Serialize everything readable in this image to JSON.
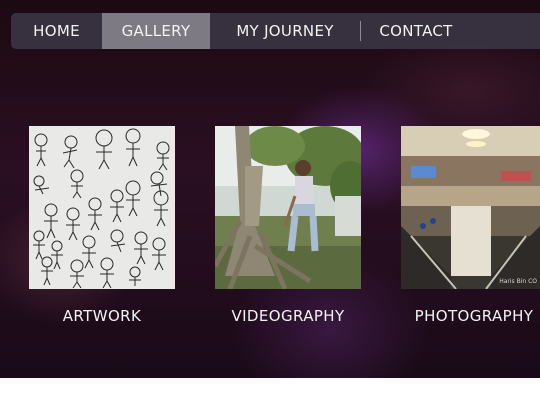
{
  "nav": {
    "items": [
      {
        "label": "HOME",
        "active": false
      },
      {
        "label": "GALLERY",
        "active": true
      },
      {
        "label": "MY JOURNEY",
        "active": false
      },
      {
        "label": "CONTACT",
        "active": false
      }
    ]
  },
  "gallery": {
    "cards": [
      {
        "label": "ARTWORK",
        "image": "chibi-sketch-sheet"
      },
      {
        "label": "VIDEOGRAPHY",
        "image": "man-sitting-on-tree-roots"
      },
      {
        "label": "PHOTOGRAPHY",
        "image": "mall-atrium-escalators",
        "watermark": "Haris Bin CO"
      }
    ]
  },
  "colors": {
    "nav_bg": "#3a3442",
    "nav_active_bg": "#7d7a83",
    "text": "#f2f2f2",
    "background": "#1c0a12",
    "footer_strip": "#ffffff"
  }
}
